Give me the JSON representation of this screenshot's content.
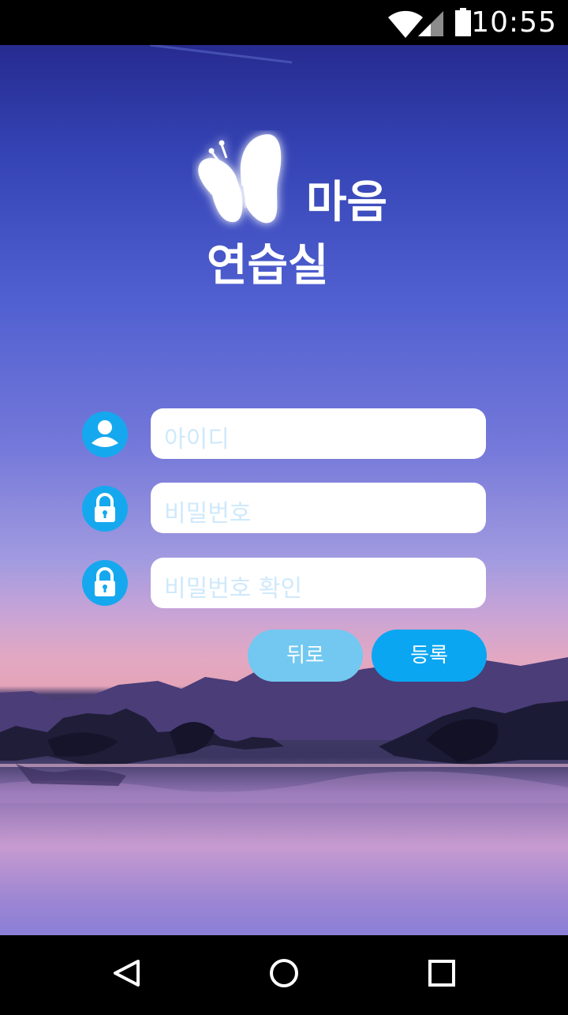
{
  "status_bar": {
    "time": "10:55",
    "icons": [
      "wifi-icon",
      "signal-icon",
      "battery-icon"
    ]
  },
  "app": {
    "title_line1": "마음",
    "title_line2": "연습실",
    "logo": "butterfly-icon"
  },
  "form": {
    "id_placeholder": "아이디",
    "password_placeholder": "비밀번호",
    "password_confirm_placeholder": "비밀번호 확인",
    "back_label": "뒤로",
    "register_label": "등록"
  },
  "nav_bar": {
    "icons": [
      "back-triangle-icon",
      "home-circle-icon",
      "recents-square-icon"
    ]
  },
  "colors": {
    "accent": "#0aa6f2",
    "accent_light": "#72c8f0",
    "placeholder": "#cfe9fb"
  }
}
